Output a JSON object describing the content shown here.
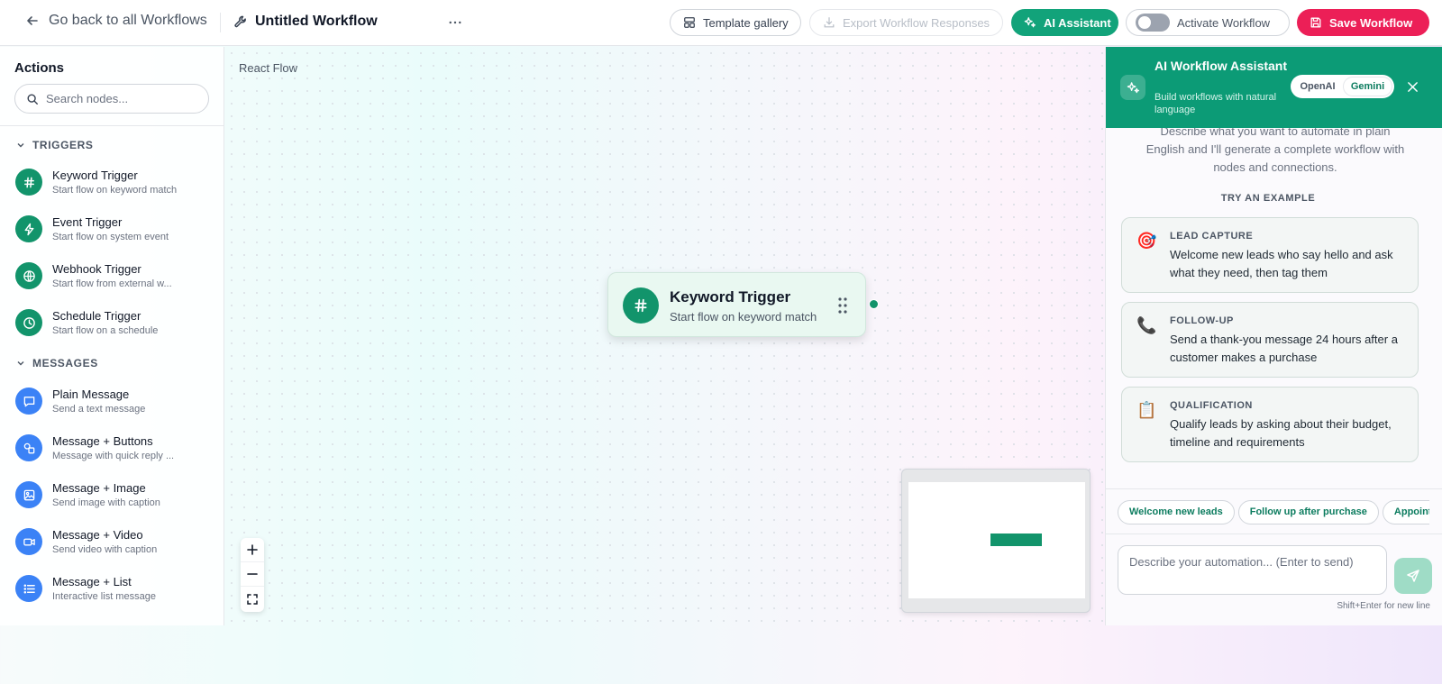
{
  "header": {
    "back_label": "Go back to all Workflows",
    "workflow_title": "Untitled Workflow",
    "template_label": "Template gallery",
    "export_label": "Export Workflow Responses",
    "ai_label": "AI Assistant",
    "activate_label": "Activate Workflow",
    "save_label": "Save Workflow"
  },
  "sidebar": {
    "title": "Actions",
    "search_placeholder": "Search nodes...",
    "sections": [
      {
        "label": "TRIGGERS",
        "items": [
          {
            "name": "Keyword Trigger",
            "desc": "Start flow on keyword match",
            "icon": "hash-icon"
          },
          {
            "name": "Event Trigger",
            "desc": "Start flow on system event",
            "icon": "bolt-icon"
          },
          {
            "name": "Webhook Trigger",
            "desc": "Start flow from external w...",
            "icon": "globe-icon"
          },
          {
            "name": "Schedule Trigger",
            "desc": "Start flow on a schedule",
            "icon": "clock-icon"
          }
        ]
      },
      {
        "label": "MESSAGES",
        "items": [
          {
            "name": "Plain Message",
            "desc": "Send a text message",
            "icon": "chat-icon"
          },
          {
            "name": "Message + Buttons",
            "desc": "Message with quick reply ...",
            "icon": "shapes-icon"
          },
          {
            "name": "Message + Image",
            "desc": "Send image with caption",
            "icon": "image-icon"
          },
          {
            "name": "Message + Video",
            "desc": "Send video with caption",
            "icon": "video-icon"
          },
          {
            "name": "Message + List",
            "desc": "Interactive list message",
            "icon": "list-icon"
          }
        ]
      }
    ]
  },
  "canvas": {
    "label": "React Flow",
    "node": {
      "title": "Keyword Trigger",
      "desc": "Start flow on keyword match"
    }
  },
  "ai_panel": {
    "title": "AI Workflow Assistant",
    "subtitle": "Build workflows with natural language",
    "provider_options": [
      "OpenAI",
      "Gemini"
    ],
    "selected_provider": "Gemini",
    "intro": "Describe what you want to automate in plain English and I'll generate a complete workflow with nodes and connections.",
    "try_label": "TRY AN EXAMPLE",
    "examples": [
      {
        "emoji": "🎯",
        "category": "LEAD CAPTURE",
        "text": "Welcome new leads who say hello and ask what they need, then tag them"
      },
      {
        "emoji": "📞",
        "category": "FOLLOW-UP",
        "text": "Send a thank-you message 24 hours after a customer makes a purchase"
      },
      {
        "emoji": "📋",
        "category": "QUALIFICATION",
        "text": "Qualify leads by asking about their budget, timeline and requirements"
      }
    ],
    "chips": [
      "Welcome new leads",
      "Follow up after purchase",
      "Appointm"
    ],
    "input_placeholder": "Describe your automation... (Enter to send)",
    "hint": "Shift+Enter for new line"
  },
  "colors": {
    "brand_green": "#12a37a",
    "save_red": "#ec1f57",
    "message_blue": "#3b82f6"
  }
}
